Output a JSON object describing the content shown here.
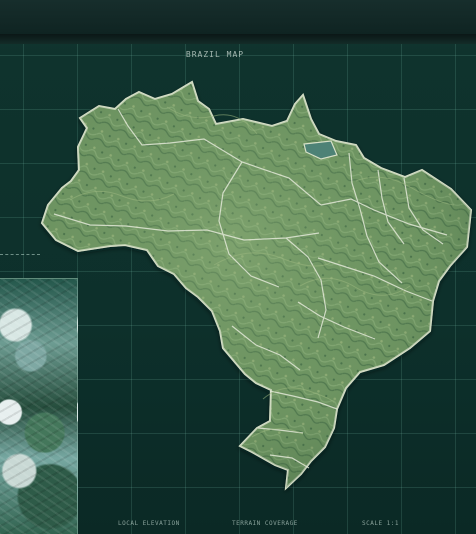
{
  "map": {
    "title": "BRAZIL MAP"
  },
  "footer": {
    "left": "LOCAL ELEVATION",
    "center": "TERRAIN COVERAGE",
    "right": "SCALE 1:1"
  },
  "colors": {
    "background": "#0d302b",
    "grid": "#4f8c7f",
    "land": "#6f9663",
    "land_shadow": "#355d3d",
    "border": "#d7e0c8",
    "inset_highlight": "#d8e7e4"
  }
}
